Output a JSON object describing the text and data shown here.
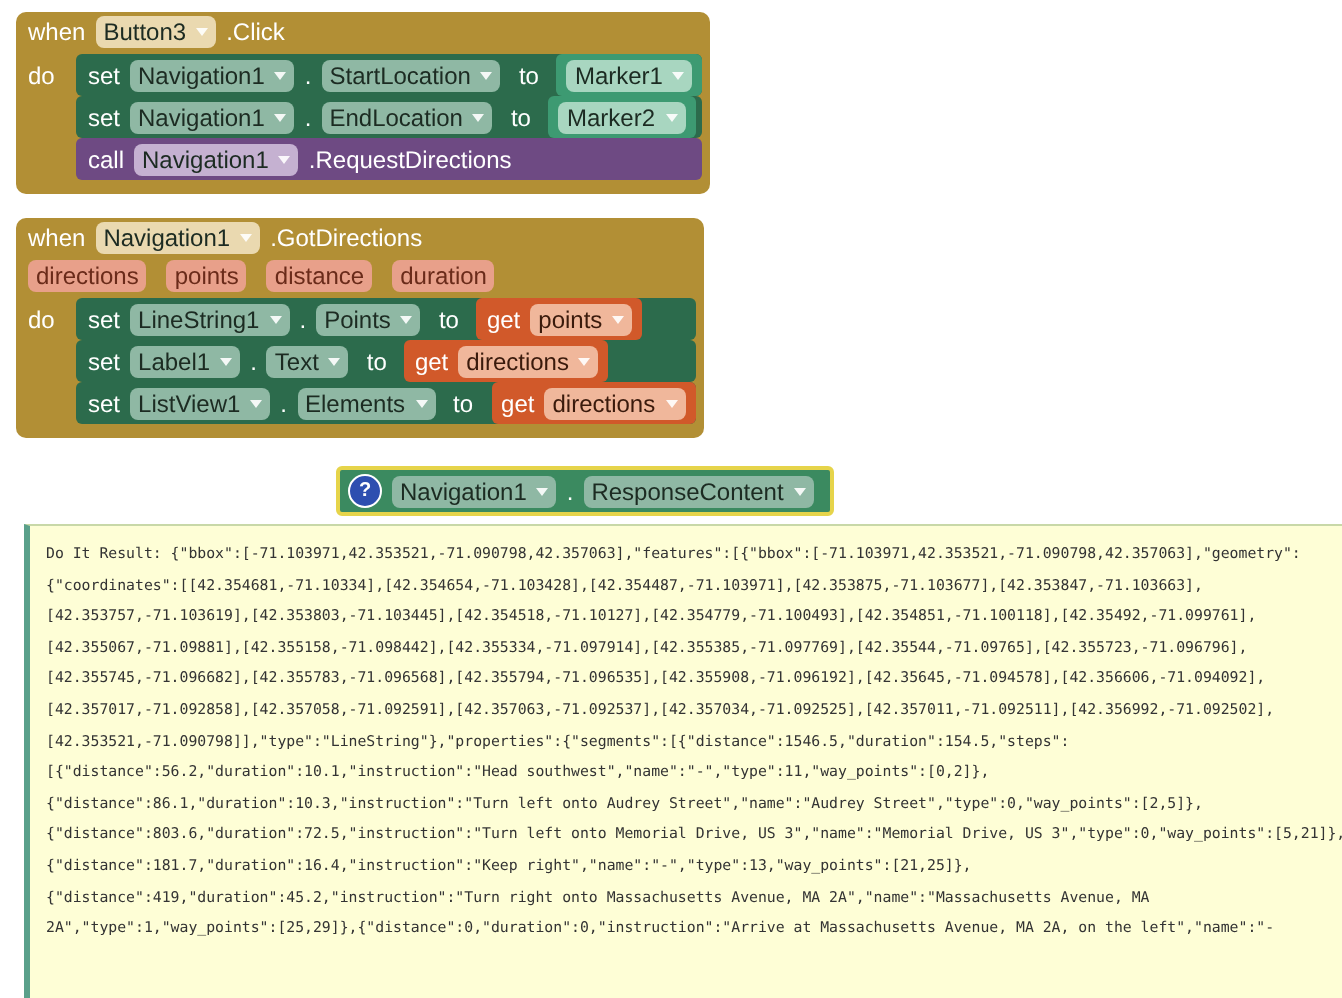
{
  "event_blocks": [
    {
      "keyword": "when",
      "component": "Button3",
      "event": ".Click",
      "do_label": "do",
      "statements": [
        {
          "kind": "set",
          "keyword": "set",
          "component": "Navigation1",
          "dot": ".",
          "property": "StartLocation",
          "to": "to",
          "value": {
            "kind": "component",
            "component": "Marker1"
          }
        },
        {
          "kind": "set",
          "keyword": "set",
          "component": "Navigation1",
          "dot": ".",
          "property": "EndLocation",
          "to": "to",
          "value": {
            "kind": "component",
            "component": "Marker2"
          }
        },
        {
          "kind": "call",
          "keyword": "call",
          "component": "Navigation1",
          "method": ".RequestDirections"
        }
      ]
    },
    {
      "keyword": "when",
      "component": "Navigation1",
      "event": ".GotDirections",
      "parameters": [
        "directions",
        "points",
        "distance",
        "duration"
      ],
      "do_label": "do",
      "statements": [
        {
          "kind": "set",
          "keyword": "set",
          "component": "LineString1",
          "dot": ".",
          "property": "Points",
          "to": "to",
          "value": {
            "kind": "get",
            "keyword": "get",
            "variable": "points"
          }
        },
        {
          "kind": "set",
          "keyword": "set",
          "component": "Label1",
          "dot": ".",
          "property": "Text",
          "to": "to",
          "value": {
            "kind": "get",
            "keyword": "get",
            "variable": "directions"
          }
        },
        {
          "kind": "set",
          "keyword": "set",
          "component": "ListView1",
          "dot": ".",
          "property": "Elements",
          "to": "to",
          "value": {
            "kind": "get",
            "keyword": "get",
            "variable": "directions"
          }
        }
      ]
    }
  ],
  "getter_block": {
    "help_badge": "?",
    "component": "Navigation1",
    "dot": ".",
    "property": "ResponseContent"
  },
  "result_lines": [
    "Do It Result: {\"bbox\":[-71.103971,42.353521,-71.090798,42.357063],\"features\":[{\"bbox\":[-71.103971,42.353521,-71.090798,42.357063],\"geometry\":",
    "{\"coordinates\":[[42.354681,-71.10334],[42.354654,-71.103428],[42.354487,-71.103971],[42.353875,-71.103677],[42.353847,-71.103663],",
    "[42.353757,-71.103619],[42.353803,-71.103445],[42.354518,-71.10127],[42.354779,-71.100493],[42.354851,-71.100118],[42.35492,-71.099761],",
    "[42.355067,-71.09881],[42.355158,-71.098442],[42.355334,-71.097914],[42.355385,-71.097769],[42.35544,-71.09765],[42.355723,-71.096796],",
    "[42.355745,-71.096682],[42.355783,-71.096568],[42.355794,-71.096535],[42.355908,-71.096192],[42.35645,-71.094578],[42.356606,-71.094092],",
    "[42.357017,-71.092858],[42.357058,-71.092591],[42.357063,-71.092537],[42.357034,-71.092525],[42.357011,-71.092511],[42.356992,-71.092502],",
    "[42.353521,-71.090798]],\"type\":\"LineString\"},\"properties\":{\"segments\":[{\"distance\":1546.5,\"duration\":154.5,\"steps\":",
    "[{\"distance\":56.2,\"duration\":10.1,\"instruction\":\"Head southwest\",\"name\":\"-\",\"type\":11,\"way_points\":[0,2]},",
    "{\"distance\":86.1,\"duration\":10.3,\"instruction\":\"Turn left onto Audrey Street\",\"name\":\"Audrey Street\",\"type\":0,\"way_points\":[2,5]},",
    "{\"distance\":803.6,\"duration\":72.5,\"instruction\":\"Turn left onto Memorial Drive, US 3\",\"name\":\"Memorial Drive, US 3\",\"type\":0,\"way_points\":[5,21]},",
    "{\"distance\":181.7,\"duration\":16.4,\"instruction\":\"Keep right\",\"name\":\"-\",\"type\":13,\"way_points\":[21,25]},",
    "{\"distance\":419,\"duration\":45.2,\"instruction\":\"Turn right onto Massachusetts Avenue, MA 2A\",\"name\":\"Massachusetts Avenue, MA",
    "2A\",\"type\":1,\"way_points\":[25,29]},{\"distance\":0,\"duration\":0,\"instruction\":\"Arrive at Massachusetts Avenue, MA 2A, on the left\",\"name\":\"-"
  ]
}
